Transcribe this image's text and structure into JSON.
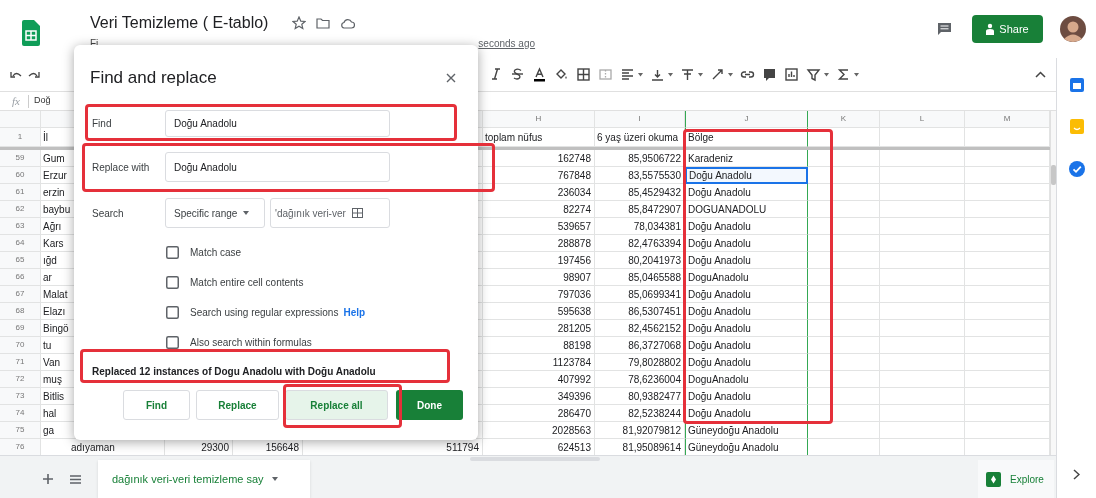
{
  "doc": {
    "title": "Veri Temizleme ( E-tablo)",
    "menu_fragment": "Fi",
    "last_edit": "seconds ago"
  },
  "share_button": "Share",
  "formula_bar": {
    "fx": "fx",
    "value": "Doğ"
  },
  "columns": [
    "H",
    "I",
    "J",
    "K",
    "L",
    "M"
  ],
  "header_row": {
    "number": "1",
    "a": "İl",
    "h": "toplam nüfus",
    "i": "6 yaş üzeri okuma",
    "j": "Bölge"
  },
  "rows": [
    {
      "number": "59",
      "a": "Gum",
      "h": "162748",
      "i": "85,9506722",
      "j": "Karadeniz",
      "selected": false
    },
    {
      "number": "60",
      "a": "Erzur",
      "h": "767848",
      "i": "83,5575530",
      "j": "Doğu Anadolu",
      "selected": true
    },
    {
      "number": "61",
      "a": "erzin",
      "h": "236034",
      "i": "85,4529432",
      "j": "Doğu Anadolu",
      "selected": false
    },
    {
      "number": "62",
      "a": "baybu",
      "h": "82274",
      "i": "85,8472907",
      "j": "DOGUANADOLU",
      "selected": false
    },
    {
      "number": "63",
      "a": "Ağrı",
      "h": "539657",
      "i": "78,034381",
      "j": "Doğu Anadolu",
      "selected": false
    },
    {
      "number": "64",
      "a": "Kars",
      "h": "288878",
      "i": "82,4763394",
      "j": "Doğu Anadolu",
      "selected": false
    },
    {
      "number": "65",
      "a": "ığd",
      "h": "197456",
      "i": "80,2041973",
      "j": "Doğu Anadolu",
      "selected": false
    },
    {
      "number": "66",
      "a": "ar",
      "h": "98907",
      "i": "85,0465588",
      "j": "DoguAnadolu",
      "selected": false
    },
    {
      "number": "67",
      "a": "Malat",
      "h": "797036",
      "i": "85,0699341",
      "j": "Doğu Anadolu",
      "selected": false
    },
    {
      "number": "68",
      "a": "Elazı",
      "h": "595638",
      "i": "86,5307451",
      "j": "Doğu Anadolu",
      "selected": false
    },
    {
      "number": "69",
      "a": "Bingö",
      "h": "281205",
      "i": "82,4562152",
      "j": "Doğu Anadolu",
      "selected": false
    },
    {
      "number": "70",
      "a": "tu",
      "h": "88198",
      "i": "86,3727068",
      "j": "Doğu Anadolu",
      "selected": false
    },
    {
      "number": "71",
      "a": "Van",
      "h": "1123784",
      "i": "79,8028802",
      "j": "Doğu Anadolu",
      "selected": false
    },
    {
      "number": "72",
      "a": "muş",
      "h": "407992",
      "i": "78,6236004",
      "j": "DoguAnadolu",
      "selected": false
    },
    {
      "number": "73",
      "a": "Bitlis",
      "h": "349396",
      "i": "80,9382477",
      "j": "Doğu Anadolu",
      "selected": false
    },
    {
      "number": "74",
      "a": "hal",
      "h": "286470",
      "i": "82,5238244",
      "j": "Doğu Anadolu",
      "selected": false
    },
    {
      "number": "75",
      "a": "ga",
      "h": "2028563",
      "i": "81,92079812",
      "j": "Güneydoğu Anadolu",
      "selected": false
    },
    {
      "number": "76",
      "a": "adıyaman",
      "b": "29300",
      "c": "156648",
      "d": "511794",
      "h": "624513",
      "i": "81,95089614",
      "j": "Güneydoğu Anadolu",
      "selected": false
    }
  ],
  "dialog": {
    "title": "Find and replace",
    "find": {
      "label": "Find",
      "value": "Doğu Anadolu"
    },
    "replace": {
      "label": "Replace with",
      "value": "Doğu Anadolu"
    },
    "search": {
      "label": "Search",
      "scope": "Specific range",
      "range": "'dağınık veri-ver"
    },
    "options": [
      {
        "label": "Match case",
        "checked": false
      },
      {
        "label": "Match entire cell contents",
        "checked": false
      },
      {
        "label": "Search using regular expressions",
        "checked": false,
        "link": "Help"
      },
      {
        "label": "Also search within formulas",
        "checked": false
      }
    ],
    "message": "Replaced 12 instances of Dogu Anadolu with Doğu Anadolu",
    "buttons": [
      {
        "label": "Find",
        "kind": "plain"
      },
      {
        "label": "Replace",
        "kind": "plain"
      },
      {
        "label": "Replace all",
        "kind": "focused"
      },
      {
        "label": "Done",
        "kind": "primary"
      }
    ]
  },
  "sheet_tab": {
    "label": "dağınık veri-veri temizleme say",
    "selected": true
  },
  "explore": "Explore"
}
